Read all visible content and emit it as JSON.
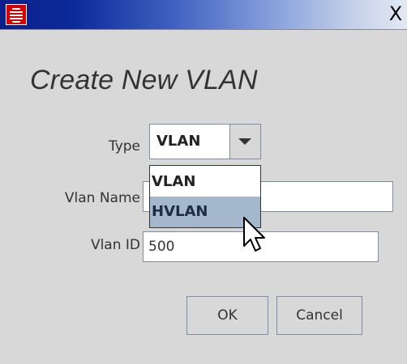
{
  "window": {
    "app_icon": "red-striped-app-icon",
    "close_label": "X"
  },
  "dialog": {
    "title": "Create New VLAN"
  },
  "form": {
    "type_label": "Type",
    "type_value": "VLAN",
    "type_options": [
      "VLAN",
      "HVLAN"
    ],
    "highlighted_option": "HVLAN",
    "vlan_name_label": "Vlan Name",
    "vlan_name_value": "",
    "vlan_id_label": "Vlan ID",
    "vlan_id_value": "500"
  },
  "buttons": {
    "ok_label": "OK",
    "cancel_label": "Cancel"
  },
  "colors": {
    "dialog_bg": "#d8d8d8",
    "titlebar_start": "#0a1f8a",
    "titlebar_end": "#e4e8f3",
    "highlight": "#a3b8cc",
    "app_icon_red": "#d80000"
  }
}
